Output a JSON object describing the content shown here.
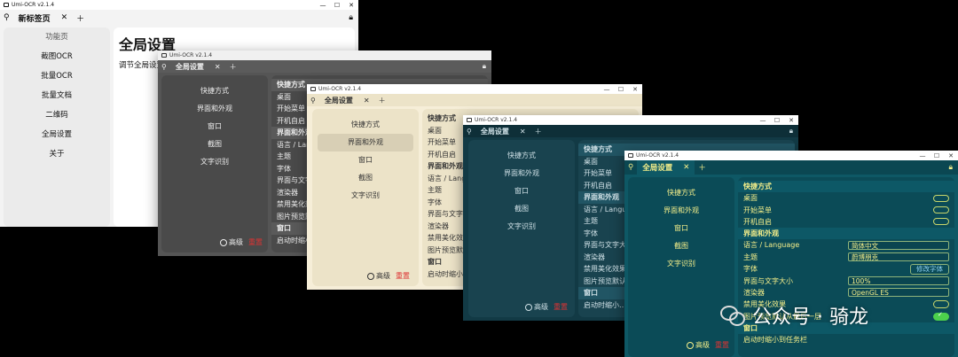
{
  "app_title": "Umi-OCR v2.1.4",
  "windows": {
    "w1": {
      "tab": "新标签页",
      "sidebar_header": "功能页",
      "sidebar": [
        "截图OCR",
        "批量OCR",
        "批量文档",
        "二维码",
        "全局设置",
        "关于"
      ],
      "main_title": "全局设置",
      "main_sub": "调节全局设置"
    },
    "w2": {
      "tab": "全局设置",
      "sidebar": [
        "快捷方式",
        "界面和外观",
        "窗口",
        "截图",
        "文字识别"
      ],
      "main": [
        "快捷方式",
        "桌面",
        "开始菜单",
        "开机自启",
        "界面和外观",
        "语言 / Language",
        "主题",
        "字体",
        "界面与文字大小",
        "渲染器",
        "禁用美化效果",
        "图片预览默认…",
        "窗口",
        "启动时缩小到…"
      ],
      "adv": "高级",
      "reset": "重置"
    },
    "w3": {
      "tab": "全局设置",
      "sidebar": [
        "快捷方式",
        "界面和外观",
        "窗口",
        "截图",
        "文字识别"
      ],
      "main": [
        "快捷方式",
        "桌面",
        "开始菜单",
        "开机自启",
        "界面和外观",
        "语言 / Language",
        "主题",
        "字体",
        "界面与文字大小",
        "渲染器",
        "禁用美化效果",
        "图片预览默认…",
        "窗口",
        "启动时缩小到…"
      ],
      "adv": "高级",
      "reset": "重置"
    },
    "w4": {
      "tab": "全局设置",
      "sidebar": [
        "快捷方式",
        "界面和外观",
        "窗口",
        "截图",
        "文字识别"
      ],
      "main": [
        "快捷方式",
        "桌面",
        "开始菜单",
        "开机自启",
        "界面和外观",
        "语言 / Language",
        "主题",
        "字体",
        "界面与文字大小",
        "渲染器",
        "禁用美化效果",
        "图片预览默认…",
        "窗口",
        "启动时缩小…"
      ],
      "adv": "高级",
      "reset": "重置"
    },
    "w5": {
      "tab": "全局设置",
      "sidebar": [
        "快捷方式",
        "界面和外观",
        "窗口",
        "截图",
        "文字识别"
      ],
      "group_shortcut": "快捷方式",
      "desktop": "桌面",
      "start_menu": "开始菜单",
      "autostart": "开机自启",
      "group_ui": "界面和外观",
      "language_label": "语言 / Language",
      "language_value": "简体中文",
      "theme_label": "主题",
      "theme_value": "蔚博朋克",
      "font_label": "字体",
      "font_button": "修改字体",
      "size_label": "界面与文字大小",
      "size_value": "100%",
      "renderer_label": "渲染器",
      "renderer_value": "OpenGL ES",
      "disable_fx_label": "禁用美化效果",
      "preview_label": "图片预览默认从最后一层",
      "group_window": "窗口",
      "window_row": "启动时缩小到任务栏",
      "adv": "高级",
      "reset": "重置"
    }
  },
  "watermark": "公众号 · 骑龙",
  "colors": {
    "reset": "#dd3333",
    "toggle_on": "#4cd04c"
  }
}
